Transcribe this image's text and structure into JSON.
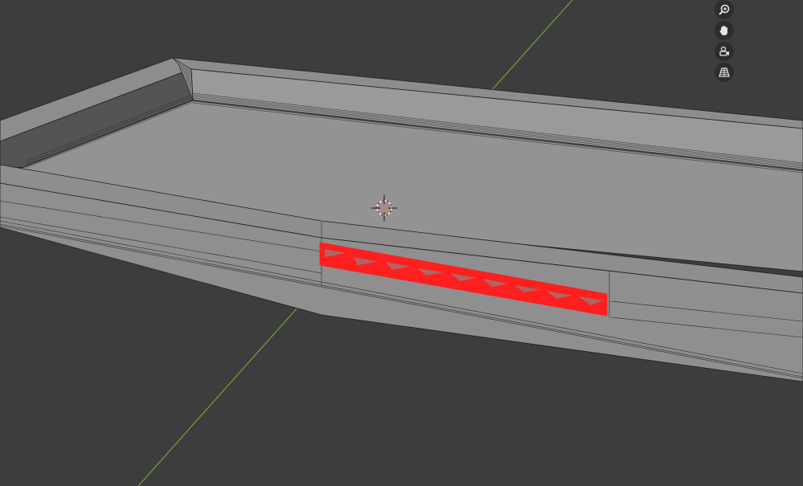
{
  "viewport": {
    "background": "#3d3d3d",
    "mode": "edit-mode-wireframe-overlay",
    "object": "tray-mesh",
    "selection_color": "#ff1f1f",
    "floor_axis_color": "#6f9a3a"
  },
  "navigation_gizmo": {
    "buttons": [
      {
        "name": "zoom",
        "icon": "zoom-icon"
      },
      {
        "name": "pan",
        "icon": "hand-icon"
      },
      {
        "name": "camera",
        "icon": "camera-view-icon"
      },
      {
        "name": "perspective",
        "icon": "grid-perspective-icon"
      }
    ]
  },
  "cursor_3d": {
    "icon": "3d-cursor-icon"
  }
}
